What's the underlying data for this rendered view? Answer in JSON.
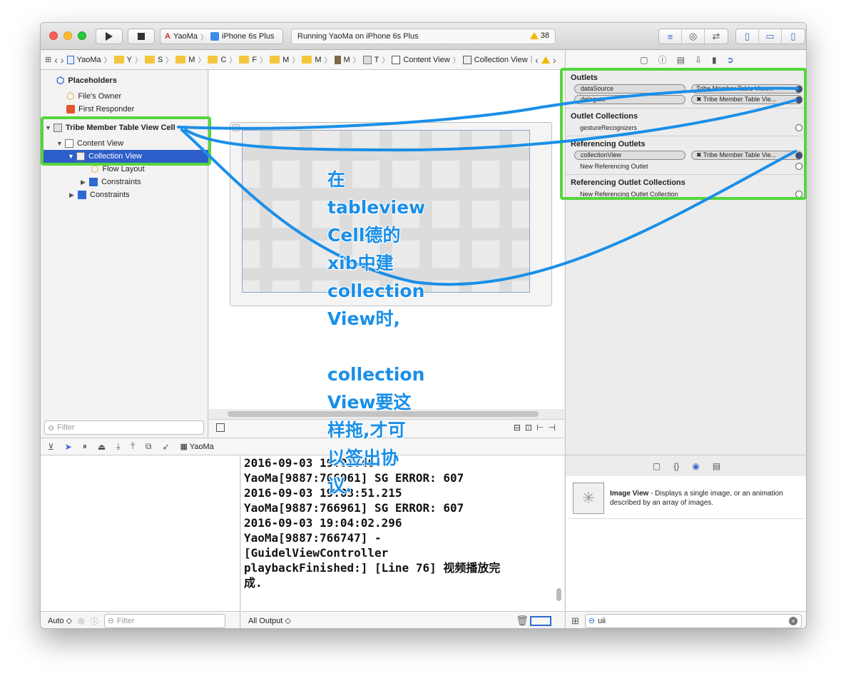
{
  "toolbar": {
    "scheme": "YaoMa",
    "device": "iPhone 6s Plus",
    "status": "Running YaoMa on iPhone 6s Plus",
    "warnings": "38"
  },
  "jumpbar": {
    "crumbs": [
      "YaoMa",
      "Y",
      "S",
      "M",
      "C",
      "F",
      "M",
      "M",
      "M",
      "T"
    ],
    "content_view": "Content View",
    "collection_view": "Collection View"
  },
  "navigator": {
    "placeholders": "Placeholders",
    "files_owner": "File's Owner",
    "first_responder": "First Responder",
    "cell": "Tribe Member Table View Cell",
    "content_view": "Content View",
    "collection_view": "Collection View",
    "flow_layout": "Flow Layout",
    "constraints_inner": "Constraints",
    "constraints_outer": "Constraints",
    "filter_placeholder": "Filter"
  },
  "inspector": {
    "outlets_title": "Outlets",
    "datasource": "dataSource",
    "delegate": "delegate",
    "datasource_target": "Tribe Member Table View...",
    "delegate_target": "Tribe Member Table Vie...",
    "outlet_collections_title": "Outlet Collections",
    "gesture": "gestureRecognizers",
    "ref_outlets_title": "Referencing Outlets",
    "collectionview": "collectionView",
    "collectionview_target": "Tribe Member Table Vie...",
    "new_ref_outlet": "New Referencing Outlet",
    "ref_collections_title": "Referencing Outlet Collections",
    "new_ref_collection": "New Referencing Outlet Collection"
  },
  "debug": {
    "process": "YaoMa"
  },
  "console": {
    "text": "2016-09-03 19:03:46\nYaoMa[9887:766961] SG ERROR: 607\n2016-09-03 19:03:51.215\nYaoMa[9887:766961] SG ERROR: 607\n2016-09-03 19:04:02.296\nYaoMa[9887:766747] -\n[GuidelViewController\nplaybackFinished:] [Line 76] 视频播放完\n成.",
    "output_selector": "All Output ◇"
  },
  "vars": {
    "auto": "Auto ◇",
    "filter_placeholder": "Filter"
  },
  "library": {
    "title": "Image View",
    "desc": " - Displays a single image, or an animation described by an array of images.",
    "search_value": "uii"
  },
  "annotation": {
    "lines": [
      "在",
      "tableview",
      "Cell德的",
      "xib中建",
      "collection",
      "View时,",
      "",
      "collection",
      "View要这",
      "样拖,才可",
      "以签出协",
      "议."
    ]
  },
  "colors": {
    "annotation_blue": "#1a8fe8",
    "highlight_green": "#55d63a",
    "selection_blue": "#2d5ec9"
  }
}
